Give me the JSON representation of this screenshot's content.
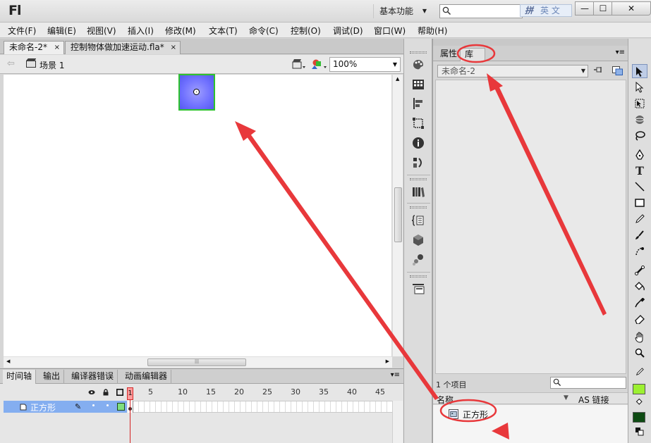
{
  "app": {
    "logo": "Fl",
    "workspace": "基本功能",
    "ime_label": "英 文",
    "ime_glyph": "拼"
  },
  "window_controls": {
    "minimize": "—",
    "maximize": "☐",
    "close": "✕"
  },
  "menu": [
    "文件(F)",
    "编辑(E)",
    "视图(V)",
    "插入(I)",
    "修改(M)",
    "文本(T)",
    "命令(C)",
    "控制(O)",
    "调试(D)",
    "窗口(W)",
    "帮助(H)"
  ],
  "doc_tabs": [
    {
      "label": "未命名-2*",
      "close": "×"
    },
    {
      "label": "控制物体做加速运动.fla*",
      "close": "×"
    }
  ],
  "editbar": {
    "scene_label": "场景 1",
    "zoom": "100%"
  },
  "timeline": {
    "tabs": [
      "时间轴",
      "输出",
      "编译器错误",
      "动画编辑器"
    ],
    "frame_numbers": [
      "5",
      "10",
      "15",
      "20",
      "25",
      "30",
      "35",
      "40",
      "45"
    ],
    "current_frame": "1",
    "layer_name": "正方形"
  },
  "library": {
    "tabs": [
      "属性",
      "库"
    ],
    "active_tab": "库",
    "document": "未命名-2",
    "item_count": "1 个项目",
    "columns": {
      "name": "名称",
      "linkage": "AS 链接"
    },
    "items": [
      "正方形"
    ]
  },
  "colors": {
    "stroke": "#9cf031",
    "fill": "#0d4a12",
    "annotation": "#e8383b",
    "selection_outline": "#2ec22e"
  },
  "icons": {
    "tools": [
      "selection-tool-icon",
      "subselection-tool-icon",
      "free-transform-tool-icon",
      "3d-rotation-tool-icon",
      "lasso-tool-icon",
      "pen-tool-icon",
      "text-tool-icon",
      "line-tool-icon",
      "rectangle-tool-icon",
      "pencil-tool-icon",
      "brush-tool-icon",
      "deco-tool-icon",
      "bone-tool-icon",
      "paint-bucket-tool-icon",
      "eyedropper-tool-icon",
      "eraser-tool-icon",
      "hand-tool-icon",
      "zoom-tool-icon"
    ]
  }
}
